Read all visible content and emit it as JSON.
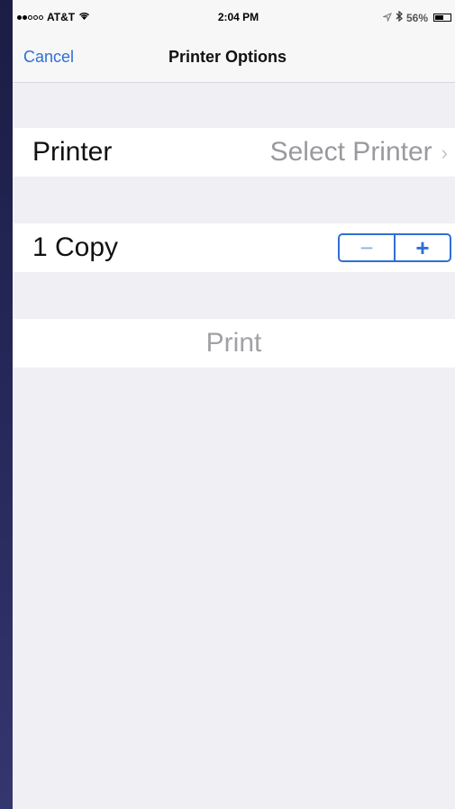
{
  "status_bar": {
    "carrier": "AT&T",
    "time": "2:04 PM",
    "battery_percent": "56%",
    "battery_level": 0.56,
    "signal_bars_filled": 2,
    "signal_bars_total": 5,
    "icons": [
      "wifi-icon",
      "location-icon",
      "bluetooth-icon",
      "battery-icon"
    ]
  },
  "nav": {
    "cancel_label": "Cancel",
    "title": "Printer Options"
  },
  "printer_row": {
    "label": "Printer",
    "value": "Select Printer",
    "chevron": "›"
  },
  "copies_row": {
    "label": "1 Copy",
    "minus": "−",
    "plus": "+"
  },
  "print_row": {
    "label": "Print"
  },
  "colors": {
    "accent": "#2f6fd6",
    "background": "#efeff4",
    "disabled_text": "#9a9a9e"
  }
}
